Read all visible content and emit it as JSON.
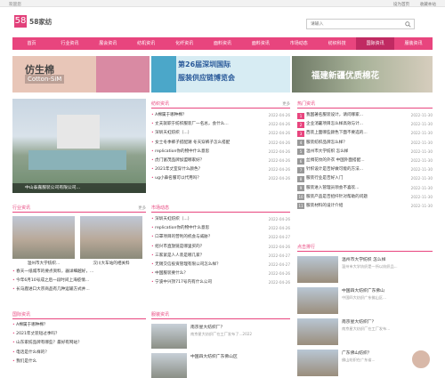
{
  "topbar": {
    "left": "欢迎您",
    "right": [
      "设为首页",
      "收藏本站"
    ]
  },
  "logo": {
    "mark": "58",
    "text": "58家纺"
  },
  "search": {
    "placeholder": "请输入",
    "icon": "search-icon"
  },
  "nav": {
    "items": [
      "首页",
      "行业资讯",
      "展会资讯",
      "纺机资讯",
      "化纤资讯",
      "面料资讯",
      "面料资讯",
      "市场动态",
      "纺织科技",
      "国际资讯",
      "服装资讯"
    ],
    "active_index": 9
  },
  "banners": [
    {
      "line1": "仿生棉",
      "line2": "Cotton-SiM"
    },
    {
      "line1": "第26届深圳国际",
      "line2": "服装供应链博览会"
    },
    {
      "line1": "福建新疆优质棉花"
    }
  ],
  "photo": {
    "caption": "中山泰嘉服装公司有限公司..."
  },
  "news_col": {
    "title": "纺织资讯",
    "more": "更多",
    "items": [
      {
        "t": "A棉属于哪种棉？",
        "d": "2022-04-26"
      },
      {
        "t": "丈夫就职于纺织服装厂一名总，会什么...",
        "d": "2022-04-26"
      },
      {
        "t": "深圳天虹纺织（...）",
        "d": "2022-04-26"
      },
      {
        "t": "女士冬季裤子搭配潮 冬天穿裤子怎么搭配",
        "d": "2022-04-26"
      },
      {
        "t": "replication你的物中什么意思",
        "d": "2022-04-26"
      },
      {
        "t": "虎门富茂品牌加盟哪家好？",
        "d": "2022-04-26"
      },
      {
        "t": "2021年丈室穿什么颜色？",
        "d": "2022-04-26"
      },
      {
        "t": "ug小鼻名服可以代用吗？",
        "d": "2022-04-26"
      }
    ]
  },
  "hot_col": {
    "title": "热门资讯",
    "items": [
      {
        "t": "我国著名服装设计，请问哪家...",
        "d": "2022-11-30"
      },
      {
        "t": "企业消暑项目怎么样高效与计...",
        "d": "2022-11-30"
      },
      {
        "t": "西装上面哪些颜色下面不要选的...",
        "d": "2022-11-30"
      },
      {
        "t": "服装纺织品牌怎么样？",
        "d": "2022-11-30"
      },
      {
        "t": "温州市大学纺织 怎么样",
        "d": "2022-11-30"
      },
      {
        "t": "丝绸花纹的外衣 中国外面搭配...",
        "d": "2022-11-30"
      },
      {
        "t": "针织设计是否好做可能的方法...",
        "d": "2022-11-30"
      },
      {
        "t": "服装行业是否好入门",
        "d": "2022-11-30"
      },
      {
        "t": "服装进入管理员领会不喜欢...",
        "d": "2022-11-30"
      },
      {
        "t": "服装产品是否招纤针对帮助的问题",
        "d": "2022-11-30"
      },
      {
        "t": "服装材料的设计介绍",
        "d": "2022-11-30"
      }
    ]
  },
  "industry": {
    "title": "行业资讯",
    "more": "更多",
    "thumbs": [
      "温州市大学纺织...",
      "汉川大车站的相关料"
    ],
    "items": [
      "春天一纸城市的要点资料，器详细越好，...",
      "今年6月10号成之后一段时间上海疫情...",
      "长马鹿进口大宗商品有几种运输方式并..."
    ]
  },
  "market": {
    "title": "市场动态",
    "items": [
      {
        "t": "深圳天虹纺织（...）",
        "d": "2022-04-26"
      },
      {
        "t": "replication你的物中什么意思",
        "d": "2022-04-26"
      },
      {
        "t": "口罩项目的营利的机会与威胁？",
        "d": "2022-04-27"
      },
      {
        "t": "绍兴市直放链是哪里买的？",
        "d": "2022-04-26"
      },
      {
        "t": "三家紧是人人装是哪几家？",
        "d": "2022-04-27"
      },
      {
        "t": "无锡交信投资管理有限公司怎么样？",
        "d": "2022-04-27"
      },
      {
        "t": "中国服装要什么？",
        "d": "2022-04-26"
      },
      {
        "t": "宁波中兴顶717号内有什么公司",
        "d": "2022-04-26"
      }
    ]
  },
  "intl": {
    "title": "国际资讯",
    "items": [
      "A棉属于哪种棉？",
      "2021年丈装短过季吗？",
      "山东家纺品牌有哪些？最好有网站？",
      "电话是什么样的？",
      "我们是什么"
    ]
  },
  "apparel": {
    "title": "服装资讯",
    "items": [
      {
        "h": "南京星大纺织厂？",
        "p": "南京星大纺织厂在工厂发布了...2022"
      },
      {
        "h": "中国四大纺织广东佛山区",
        "p": ""
      }
    ]
  },
  "recommend": {
    "title": "点击排行",
    "items": [
      {
        "h": "温州市大学纺织 怎么样",
        "p": "温州市大学纺织是一所以纺织品..."
      },
      {
        "h": "中国四大纺织广东佛山",
        "p": "中国四大纺织广东佛山区..."
      },
      {
        "h": "南京星大纺织厂？",
        "p": "南京星大纺织厂在工厂发布..."
      },
      {
        "h": "广东佛山纺织？",
        "p": "佛山纺织在广东省..."
      }
    ]
  }
}
